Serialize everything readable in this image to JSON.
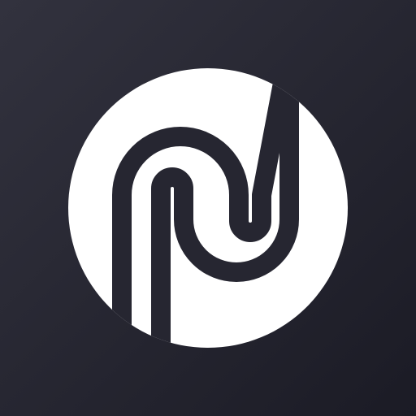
{
  "icon": {
    "name": "app-logo-icon",
    "colors": {
      "background_light": "#32323e",
      "background_dark": "#1b1b25",
      "circle": "#ffffff",
      "stroke": "#262631"
    }
  }
}
